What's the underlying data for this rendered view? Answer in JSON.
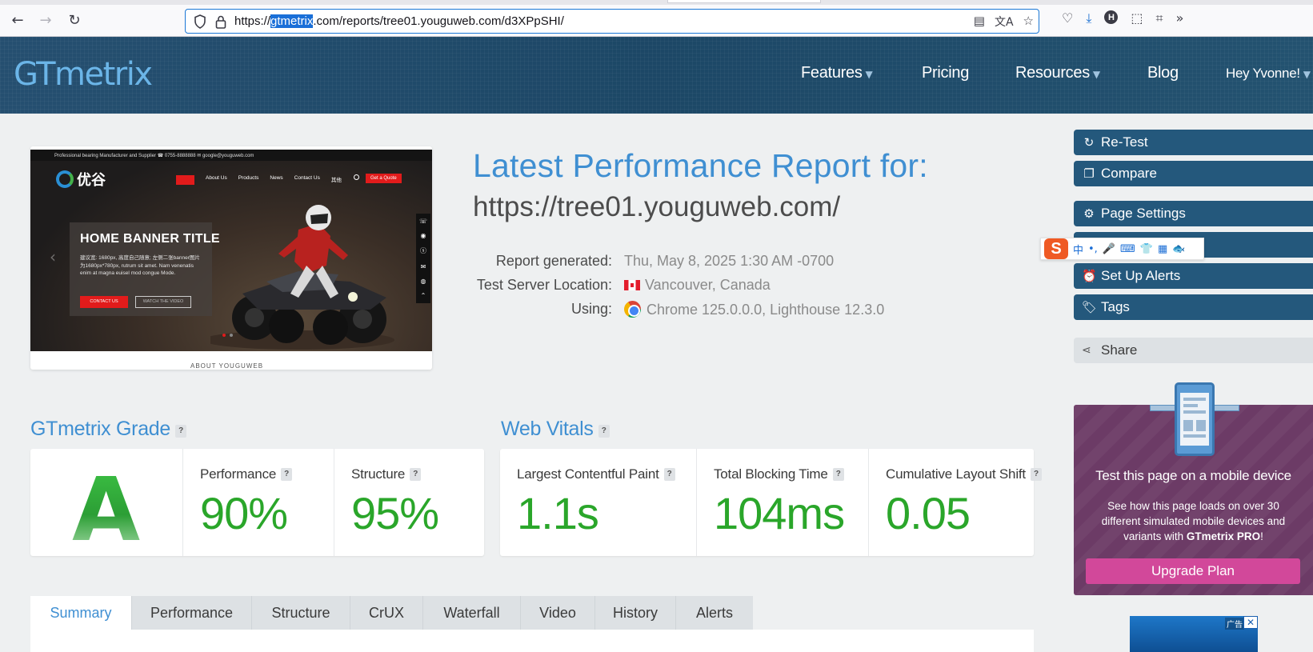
{
  "browser": {
    "url_prefix": "https://",
    "url_highlight": "gtmetrix",
    "url_rest": ".com/reports/tree01.youguweb.com/d3XPpSHI/",
    "icons": [
      "back-arrow-icon",
      "forward-arrow-icon",
      "reload-icon",
      "shield-icon",
      "lock-icon",
      "reader-view-icon",
      "translate-icon",
      "bookmark-star-icon",
      "pocket-icon",
      "download-icon",
      "profile-icon",
      "extensions-icon",
      "crop-icon",
      "overflow-chevron-icon"
    ]
  },
  "header": {
    "logo": "GTmetrix",
    "nav": {
      "features": "Features",
      "pricing": "Pricing",
      "resources": "Resources",
      "blog": "Blog",
      "user": "Hey Yvonne!"
    }
  },
  "thumbnail": {
    "topbar": "Professional bearing Manufacturer and Supplier  ☎ 0755-8888888  ✉ google@youguweb.com",
    "logo_text": "优谷",
    "menu": [
      "首页",
      "About Us",
      "Products",
      "News",
      "Contact Us",
      "其他"
    ],
    "quote_button": "Get a Quote",
    "banner_title": "HOME BANNER TITLE",
    "banner_text": "建议宽: 1680px, 高度自己随意; 左侧二张banner图片为1680px*780px, rutrum sit amet. Nam venenatis enim at magna euisel mod congue Mode.",
    "banner_button": "CONTACT US",
    "banner_button2": "WATCH THE VIDEO",
    "caption": "ABOUT YOUGUWEB"
  },
  "report": {
    "title": "Latest Performance Report for:",
    "url": "https://tree01.youguweb.com/",
    "generated_label": "Report generated:",
    "generated_value": "Thu, May 8, 2025 1:30 AM -0700",
    "location_label": "Test Server Location:",
    "location_value": "Vancouver, Canada",
    "using_label": "Using:",
    "using_value": "Chrome 125.0.0.0, Lighthouse 12.3.0"
  },
  "sidebar": {
    "retest": "Re-Test",
    "compare": "Compare",
    "page_settings": "Page Settings",
    "alerts": "Set Up Alerts",
    "tags": "Tags",
    "share": "Share"
  },
  "ime_toolbar": {
    "logo": "S",
    "items": [
      "中",
      "•,",
      "🎤",
      "⌨",
      "👕",
      "▦",
      "🐟"
    ]
  },
  "promo": {
    "title": "Test this page on a mobile device",
    "text_before": "See how this page loads on over 30 different simulated mobile devices and variants with ",
    "text_brand": "GTmetrix PRO",
    "text_after": "!",
    "button": "Upgrade Plan"
  },
  "ad": {
    "label": "广告",
    "close": "✕"
  },
  "grade": {
    "title": "GTmetrix Grade",
    "help": "?",
    "letter": "A",
    "performance_label": "Performance",
    "performance_value": "90%",
    "structure_label": "Structure",
    "structure_value": "95%"
  },
  "vitals": {
    "title": "Web Vitals",
    "help": "?",
    "lcp_label": "Largest Contentful Paint",
    "lcp_value": "1.1s",
    "tbt_label": "Total Blocking Time",
    "tbt_value": "104ms",
    "cls_label": "Cumulative Layout Shift",
    "cls_value": "0.05"
  },
  "tabs": [
    "Summary",
    "Performance",
    "Structure",
    "CrUX",
    "Waterfall",
    "Video",
    "History",
    "Alerts"
  ],
  "colors": {
    "header_blue": "#1f4c6c",
    "accent_blue": "#3f8fd2",
    "good_green": "#2aa62a",
    "sidebar_button": "#24587c",
    "promo_purple": "#6c3b66",
    "upgrade_pink": "#d2489a"
  }
}
